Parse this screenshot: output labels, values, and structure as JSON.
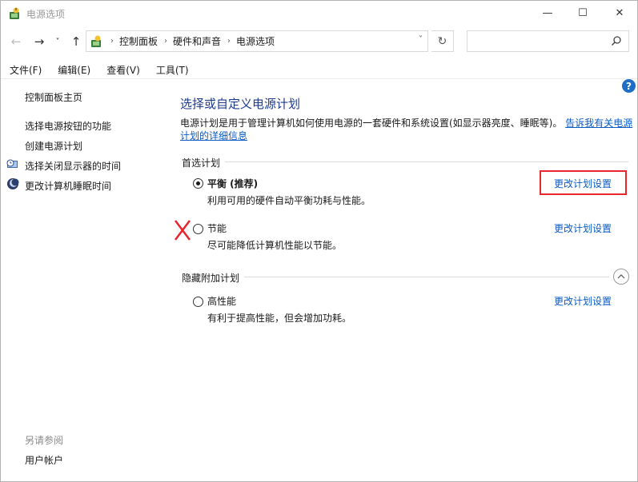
{
  "window": {
    "title": "电源选项",
    "min_glyph": "—",
    "max_glyph": "☐",
    "close_glyph": "✕"
  },
  "nav": {
    "back_glyph": "←",
    "forward_glyph": "→",
    "recent_glyph": "˅",
    "up_glyph": "↑",
    "breadcrumbs": [
      "控制面板",
      "硬件和声音",
      "电源选项"
    ],
    "sep_glyph": "›",
    "dropdown_glyph": "˅",
    "refresh_glyph": "↻",
    "search_placeholder": ""
  },
  "menu": {
    "items": [
      "文件(F)",
      "编辑(E)",
      "查看(V)",
      "工具(T)"
    ]
  },
  "sidebar": {
    "items": [
      {
        "label": "控制面板主页",
        "icon": "none"
      },
      {
        "label": "选择电源按钮的功能",
        "icon": "none"
      },
      {
        "label": "创建电源计划",
        "icon": "none"
      },
      {
        "label": "选择关闭显示器的时间",
        "icon": "monitor-clock-icon"
      },
      {
        "label": "更改计算机睡眠时间",
        "icon": "moon-icon"
      }
    ],
    "see_also_label": "另请参阅",
    "user_accounts_label": "用户帐户"
  },
  "main": {
    "help_glyph": "?",
    "title": "选择或自定义电源计划",
    "description": "电源计划是用于管理计算机如何使用电源的一套硬件和系统设置(如显示器亮度、睡眠等)。",
    "description_link": "告诉我有关电源计划的详细信息",
    "preferred_label": "首选计划",
    "hidden_label": "隐藏附加计划",
    "plans": [
      {
        "name": "平衡 (推荐)",
        "desc": "利用可用的硬件自动平衡功耗与性能。",
        "link": "更改计划设置",
        "selected": true
      },
      {
        "name": "节能",
        "desc": "尽可能降低计算机性能以节能。",
        "link": "更改计划设置",
        "selected": false
      },
      {
        "name": "高性能",
        "desc": "有利于提高性能，但会增加功耗。",
        "link": "更改计划设置",
        "selected": false
      }
    ]
  },
  "annotations": {
    "highlight_color": "#e8262b",
    "cross_mark_color": "#e8262b"
  },
  "colors": {
    "link": "#0b5bc4",
    "title": "#1e3c8c",
    "help_badge": "#1e6ec8"
  }
}
